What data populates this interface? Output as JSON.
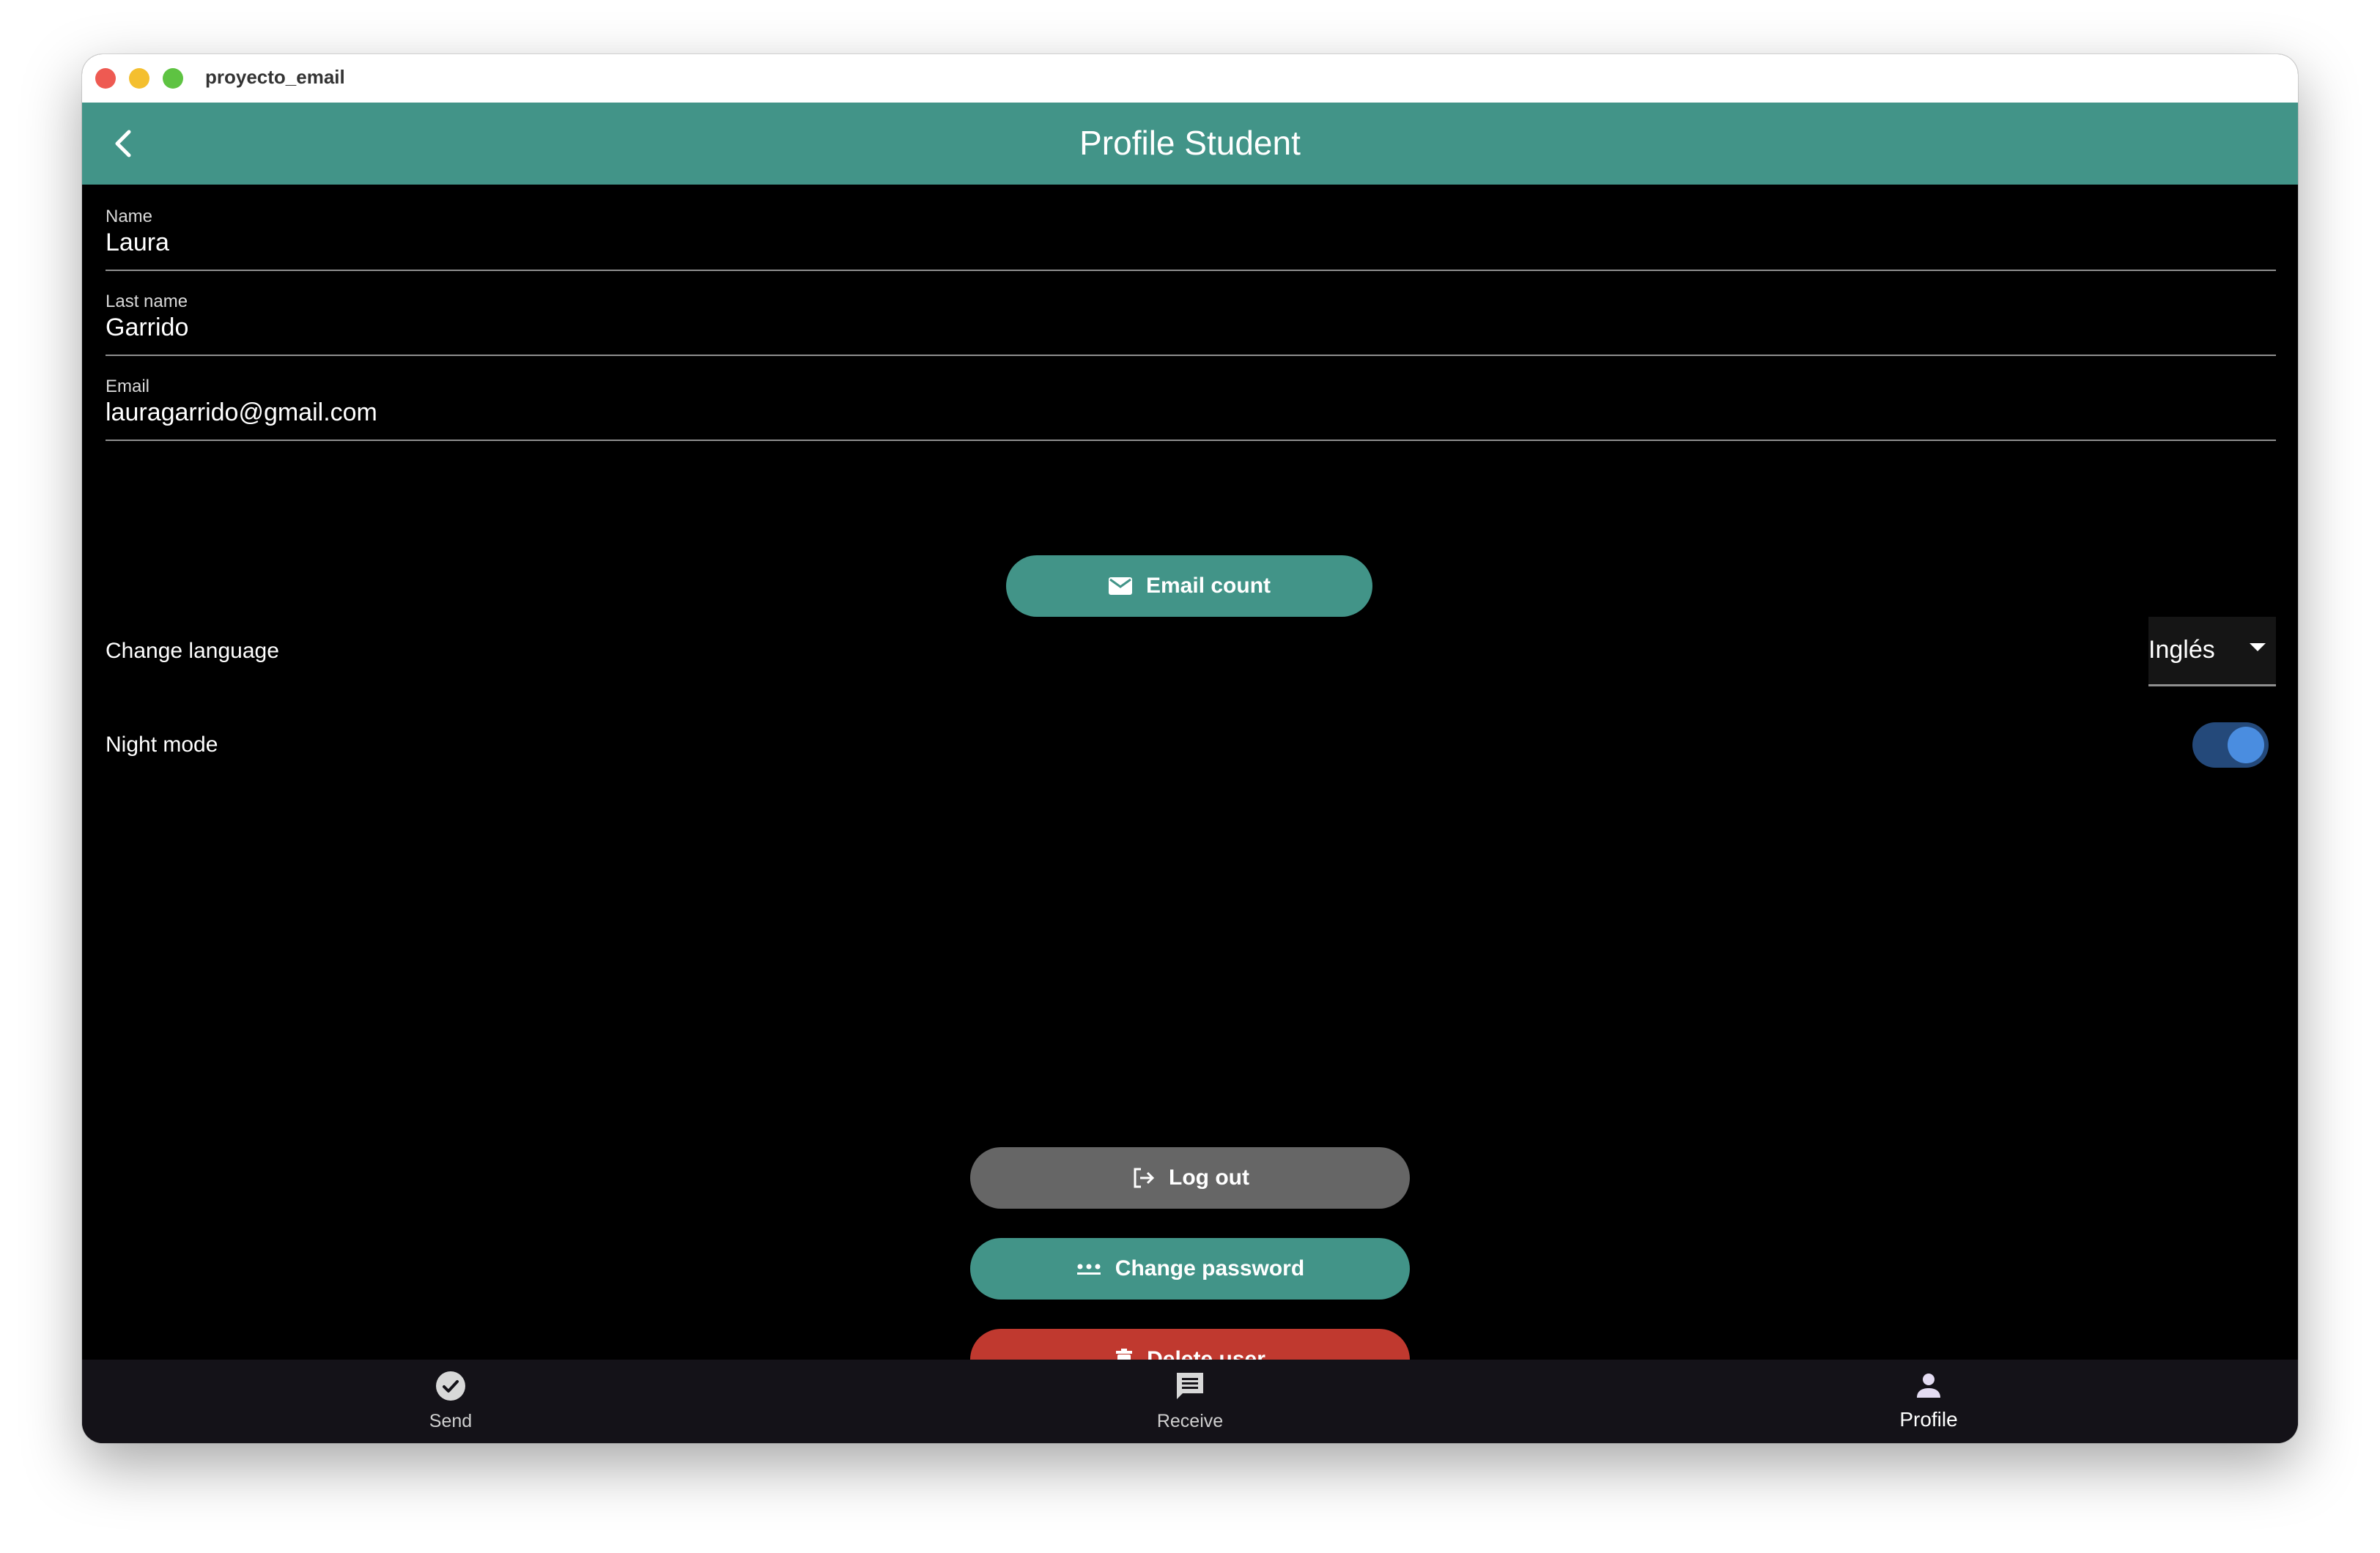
{
  "window": {
    "title": "proyecto_email"
  },
  "appbar": {
    "title": "Profile Student"
  },
  "form": {
    "name_label": "Name",
    "name_value": "Laura",
    "lastname_label": "Last name",
    "lastname_value": "Garrido",
    "email_label": "Email",
    "email_value": "lauragarrido@gmail.com"
  },
  "buttons": {
    "email_count": "Email count",
    "logout": "Log out",
    "change_password": "Change password",
    "delete_user": "Delete user"
  },
  "settings": {
    "language_label": "Change language",
    "language_value": "Inglés",
    "night_mode_label": "Night mode",
    "night_mode_on": true
  },
  "bottom_nav": {
    "items": [
      {
        "label": "Send",
        "icon": "check-circle-icon"
      },
      {
        "label": "Receive",
        "icon": "chat-bubble-icon"
      },
      {
        "label": "Profile",
        "icon": "person-icon"
      }
    ],
    "active": "Profile"
  },
  "colors": {
    "primary": "#429488",
    "danger": "#c0392f",
    "neutral_button": "#666666",
    "toggle_track": "#24497a",
    "toggle_knob": "#4a8de0",
    "nav_background": "#141218"
  }
}
